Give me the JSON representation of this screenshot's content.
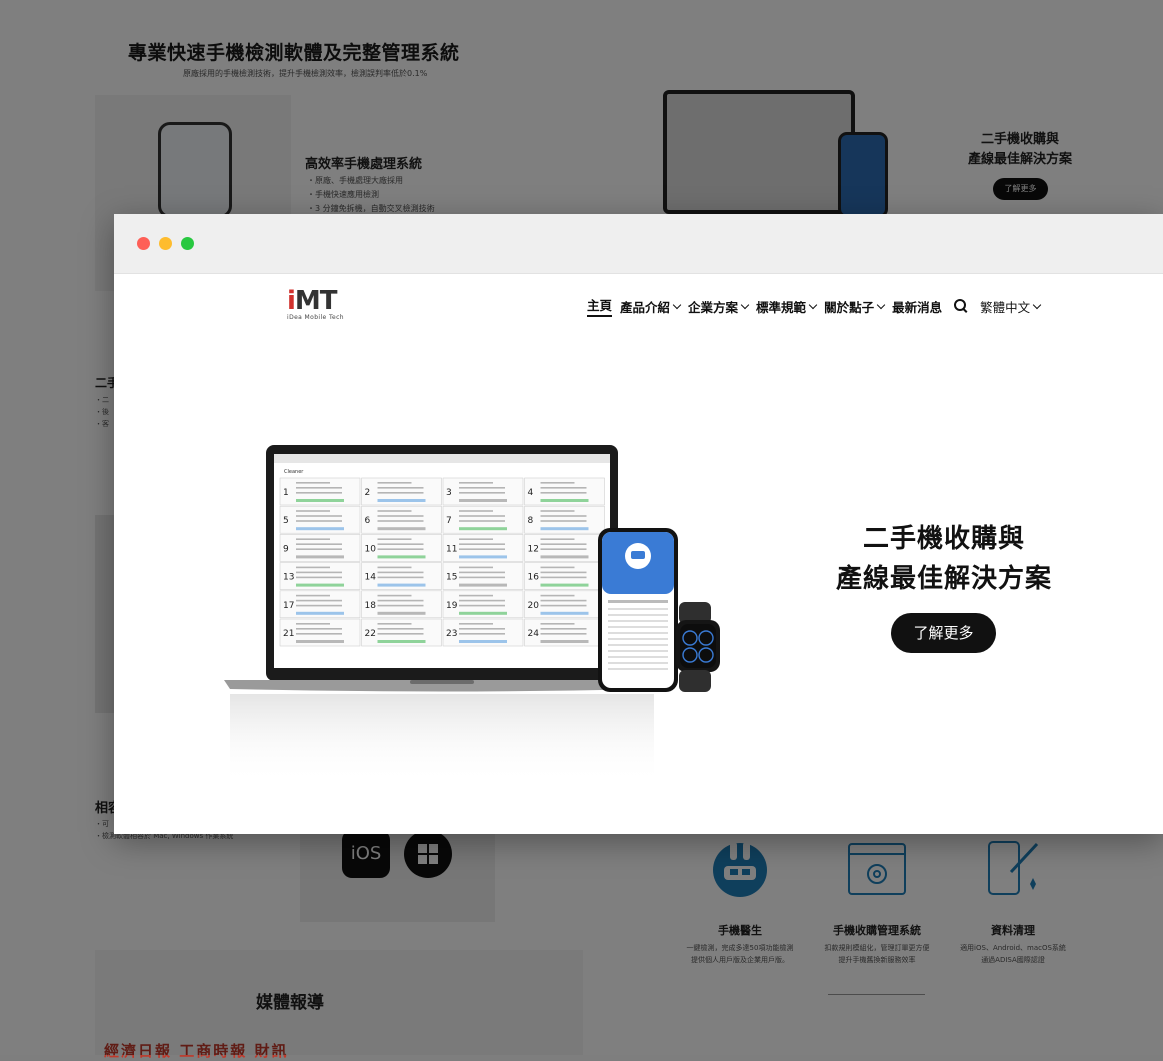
{
  "background": {
    "title": "專業快速手機檢測軟體及完整管理系統",
    "subtitle": "原廠採用的手機檢測技術，提升手機檢測效率，檢測誤判率低於0.1%",
    "feature": {
      "title": "高效率手機處理系統",
      "items": [
        "・原廠、手機處理大廠採用",
        "・手機快速應用檢測",
        "・3 分鐘免拆機，自動交叉檢測技術"
      ]
    },
    "right_title": [
      "二手機收購與",
      "產線最佳解決方案"
    ],
    "right_button": "了解更多",
    "side_heading": "二手",
    "side_bullets": [
      "・二",
      "・後",
      "・客"
    ],
    "related_title": "相容",
    "related_bullets": [
      "・可",
      "・檢測軟體相容於 Mac, Windows 作業系統"
    ],
    "os_ios": "iOS",
    "tools": [
      {
        "icon": "rabbit-doctor-icon",
        "title": "手機醫生",
        "desc": [
          "一鍵檢測，完成多達50項功能檢測",
          "提供個人用戶版及企業用戶版。"
        ]
      },
      {
        "icon": "gear-window-icon",
        "title": "手機收購管理系統",
        "desc": [
          "扣款規則模組化，管理訂單更方便",
          "提升手機舊換新服務效率"
        ]
      },
      {
        "icon": "phone-clean-icon",
        "title": "資料清理",
        "desc": [
          "適用iOS、Android、macOS系統",
          "通過ADISA國際認證"
        ]
      }
    ],
    "media_title": "媒體報導",
    "media_logos": "經濟日報  工商時報  財訊"
  },
  "logo": {
    "mark_a": "i",
    "mark_b": "MT",
    "tagline": "iDea Mobile Tech"
  },
  "nav": {
    "items": [
      {
        "label": "主頁",
        "active": true,
        "dropdown": false
      },
      {
        "label": "產品介紹",
        "dropdown": true
      },
      {
        "label": "企業方案",
        "dropdown": true
      },
      {
        "label": "標準規範",
        "dropdown": true
      },
      {
        "label": "關於點子",
        "dropdown": true
      },
      {
        "label": "最新消息",
        "dropdown": false
      }
    ],
    "language": "繁體中文"
  },
  "hero": {
    "title_line1": "二手機收購與",
    "title_line2": "產線最佳解決方案",
    "button": "了解更多",
    "screen_app": "Cleaner",
    "screen_slots": [
      "1",
      "2",
      "3",
      "4",
      "5",
      "6",
      "7",
      "8",
      "9",
      "10",
      "11",
      "12",
      "13",
      "14",
      "15",
      "16",
      "17",
      "18",
      "19",
      "20",
      "21",
      "22",
      "23",
      "24"
    ]
  },
  "colors": {
    "accent": "#111111",
    "logo_red": "#d0312d",
    "window_bar": "#efefef",
    "phone_blue": "#3a7bd5"
  }
}
